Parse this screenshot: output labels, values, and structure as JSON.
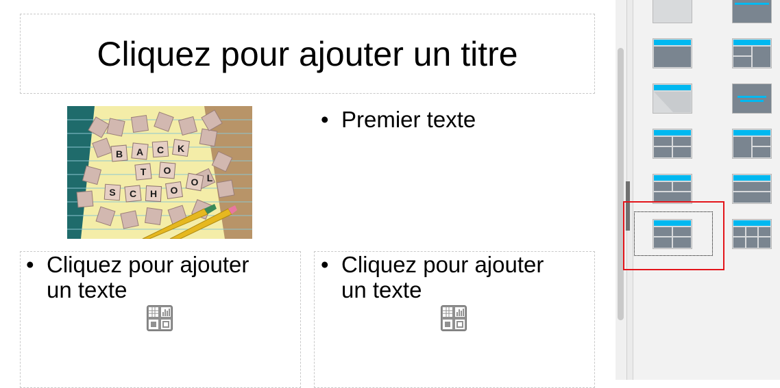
{
  "slide": {
    "title_placeholder": "Cliquez pour ajouter un titre",
    "first_text": "Premier texte",
    "left_placeholder_line1": "Cliquez pour ajouter",
    "left_placeholder_line2": "un texte",
    "right_placeholder_line1": "Cliquez pour ajouter",
    "right_placeholder_line2": "un texte",
    "bullet": "•",
    "image_tiles_text": [
      "B",
      "A",
      "C",
      "K",
      "T",
      "O",
      "S",
      "C",
      "H",
      "O",
      "O",
      "L"
    ]
  },
  "layouts_panel": {
    "items": [
      "blank-slide",
      "title-only",
      "title-content",
      "title-two-columns",
      "title-centered-text",
      "centered-text",
      "title-content-split-left",
      "title-content-split-right",
      "title-two-content-rows",
      "title-content-over-content",
      "title-four-content",
      "title-six-content"
    ],
    "selected": "title-four-content"
  },
  "colors": {
    "accent": "#00b8f0",
    "layout_gray": "#7a8590",
    "selection_red": "#e3141a"
  }
}
